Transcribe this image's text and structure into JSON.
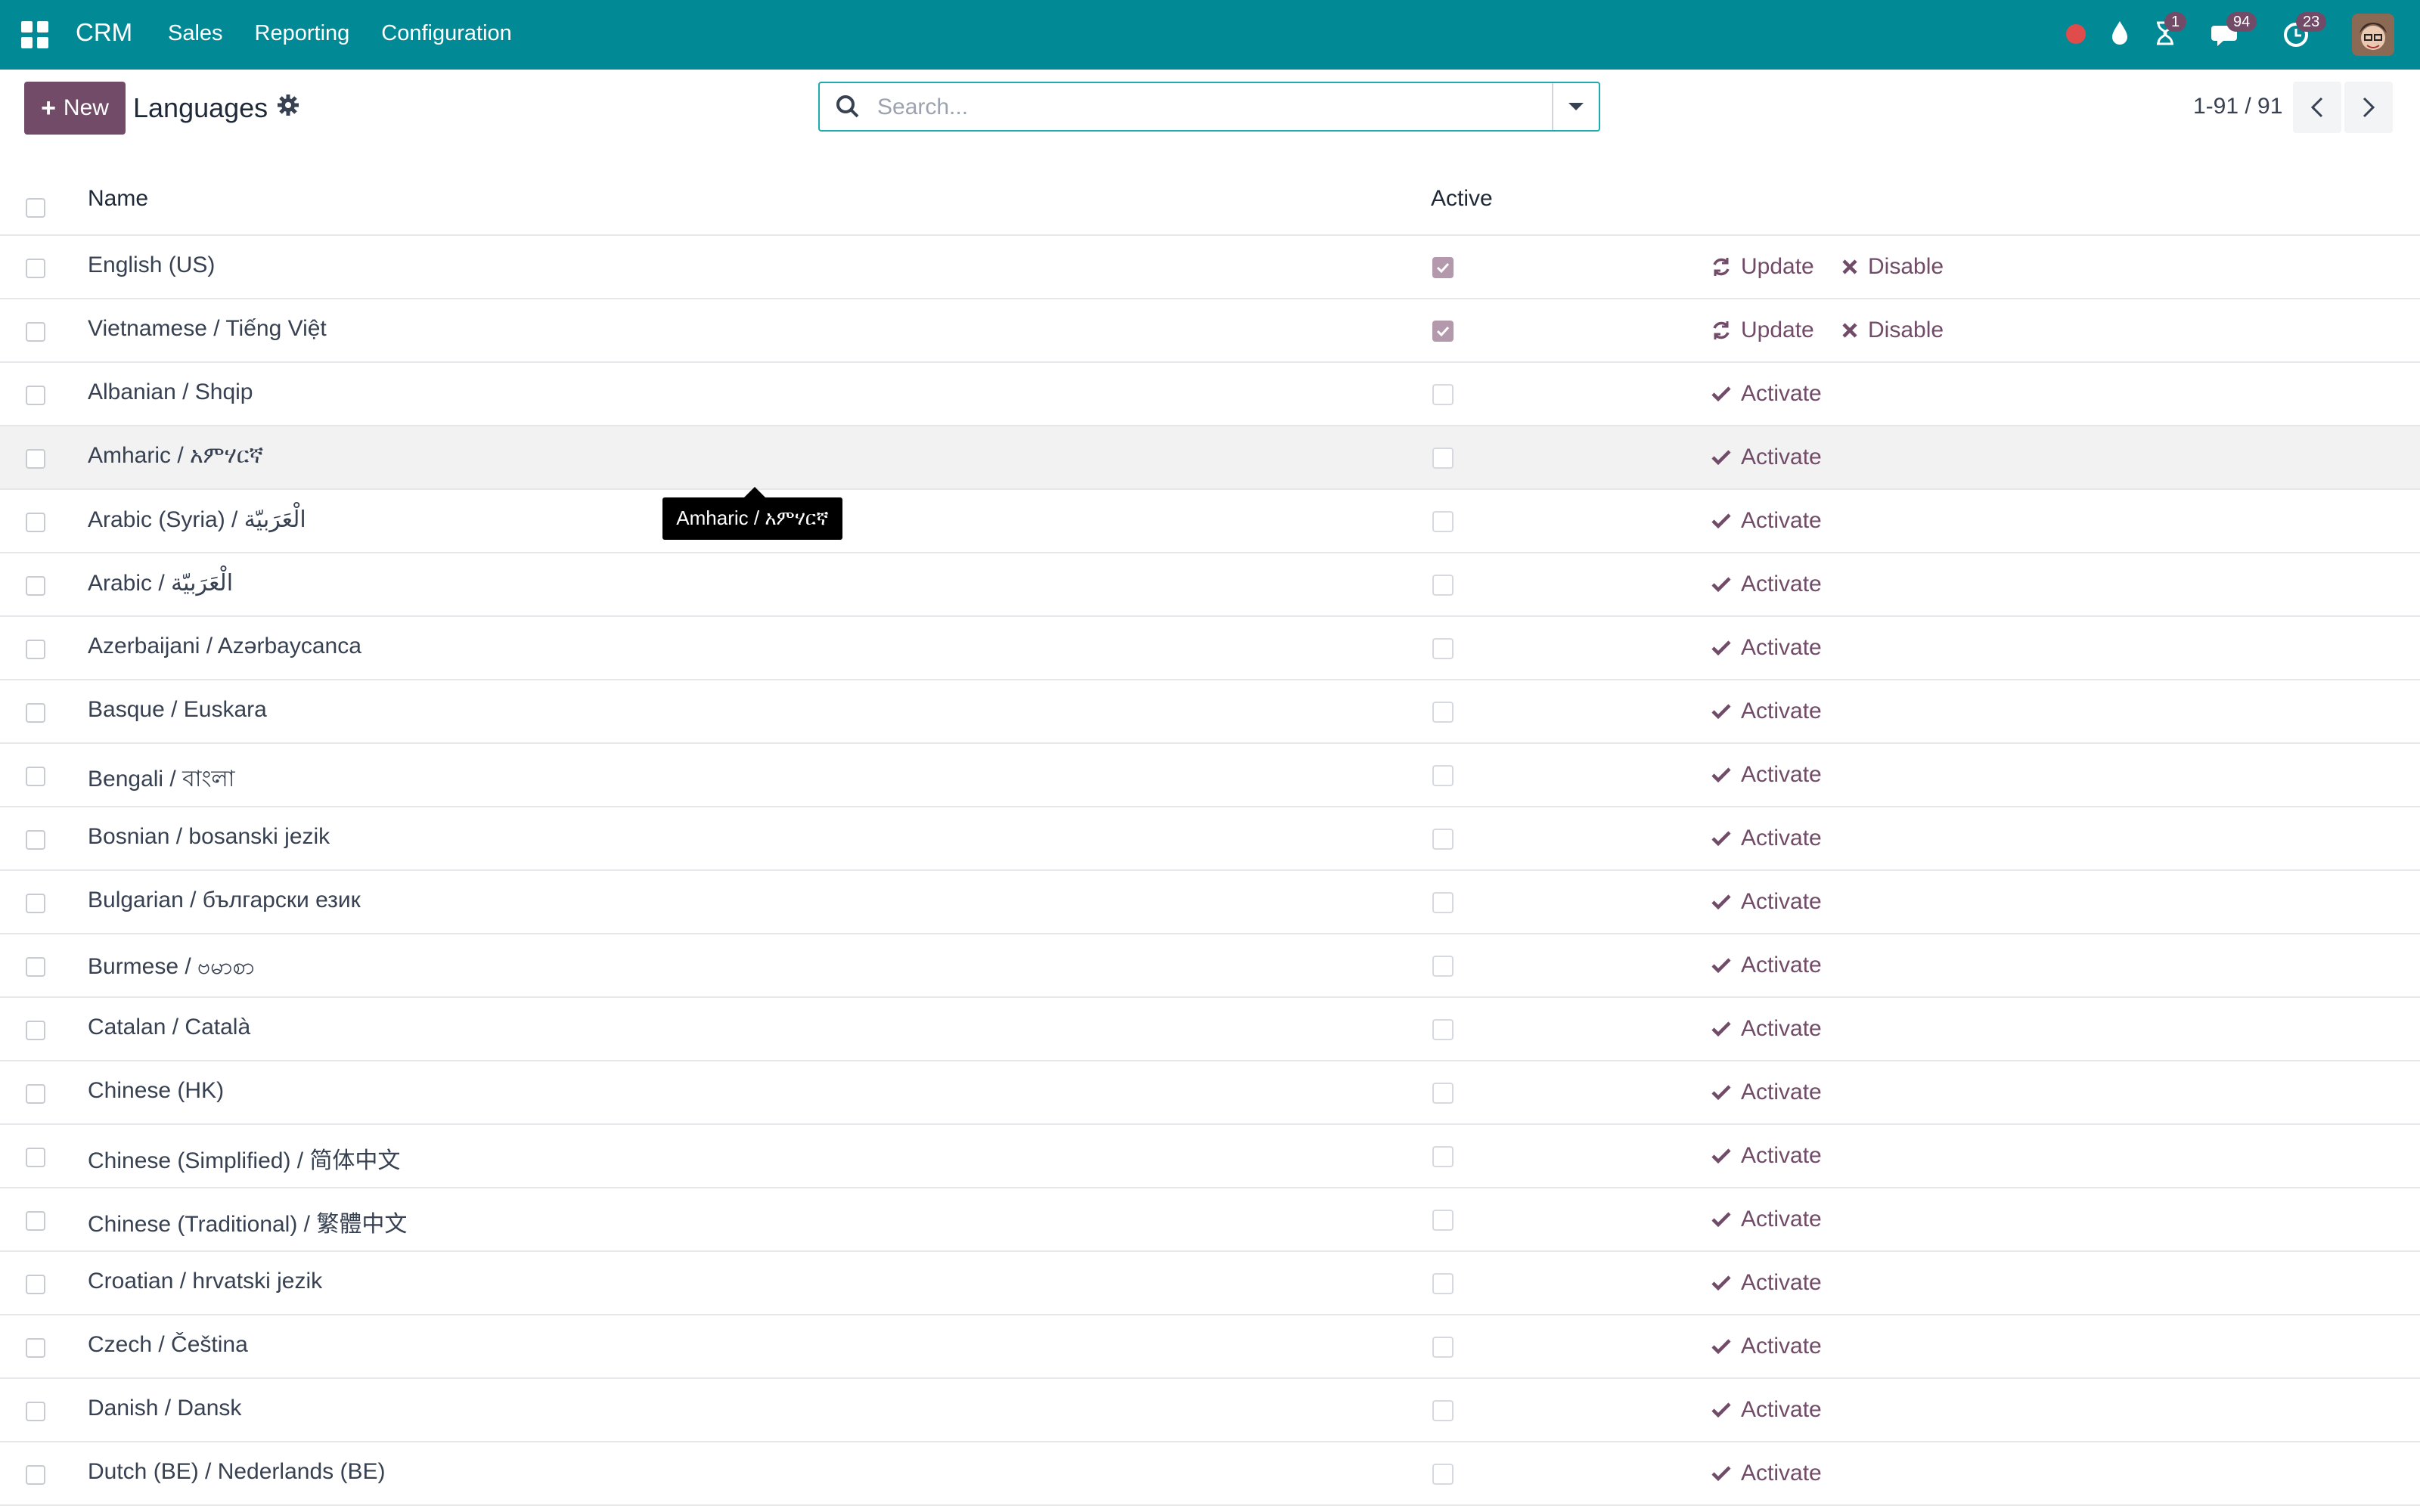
{
  "navbar": {
    "brand": "CRM",
    "menu": [
      "Sales",
      "Reporting",
      "Configuration"
    ],
    "badges": {
      "activity": "1",
      "messages": "94",
      "calendar": "23"
    }
  },
  "control": {
    "new_label": "New",
    "title": "Languages",
    "search_placeholder": "Search...",
    "pager": "1-91 / 91"
  },
  "table": {
    "headers": {
      "name": "Name",
      "active": "Active"
    },
    "rows": [
      {
        "name": "English (US)",
        "active": true,
        "actions": [
          "Update",
          "Disable"
        ]
      },
      {
        "name": "Vietnamese / Tiếng Việt",
        "active": true,
        "actions": [
          "Update",
          "Disable"
        ]
      },
      {
        "name": "Albanian / Shqip",
        "active": false,
        "actions": [
          "Activate"
        ]
      },
      {
        "name": "Amharic / አምሃርኛ",
        "active": false,
        "actions": [
          "Activate"
        ]
      },
      {
        "name": "Arabic (Syria) / الْعَرَبيّة",
        "active": false,
        "actions": [
          "Activate"
        ]
      },
      {
        "name": "Arabic / الْعَرَبيّة",
        "active": false,
        "actions": [
          "Activate"
        ]
      },
      {
        "name": "Azerbaijani / Azərbaycanca",
        "active": false,
        "actions": [
          "Activate"
        ]
      },
      {
        "name": "Basque / Euskara",
        "active": false,
        "actions": [
          "Activate"
        ]
      },
      {
        "name": "Bengali / বাংলা",
        "active": false,
        "actions": [
          "Activate"
        ]
      },
      {
        "name": "Bosnian / bosanski jezik",
        "active": false,
        "actions": [
          "Activate"
        ]
      },
      {
        "name": "Bulgarian / български език",
        "active": false,
        "actions": [
          "Activate"
        ]
      },
      {
        "name": "Burmese / ဗမာစာ",
        "active": false,
        "actions": [
          "Activate"
        ]
      },
      {
        "name": "Catalan / Català",
        "active": false,
        "actions": [
          "Activate"
        ]
      },
      {
        "name": "Chinese (HK)",
        "active": false,
        "actions": [
          "Activate"
        ]
      },
      {
        "name": "Chinese (Simplified) / 简体中文",
        "active": false,
        "actions": [
          "Activate"
        ]
      },
      {
        "name": "Chinese (Traditional) / 繁體中文",
        "active": false,
        "actions": [
          "Activate"
        ]
      },
      {
        "name": "Croatian / hrvatski jezik",
        "active": false,
        "actions": [
          "Activate"
        ]
      },
      {
        "name": "Czech / Čeština",
        "active": false,
        "actions": [
          "Activate"
        ]
      },
      {
        "name": "Danish / Dansk",
        "active": false,
        "actions": [
          "Activate"
        ]
      },
      {
        "name": "Dutch (BE) / Nederlands (BE)",
        "active": false,
        "actions": [
          "Activate"
        ]
      }
    ]
  },
  "tooltip": "Amharic / አምሃርኛ",
  "colors": {
    "navbar": "#018a95",
    "brand_purple": "#714b67",
    "search_border": "#1eaab1"
  }
}
